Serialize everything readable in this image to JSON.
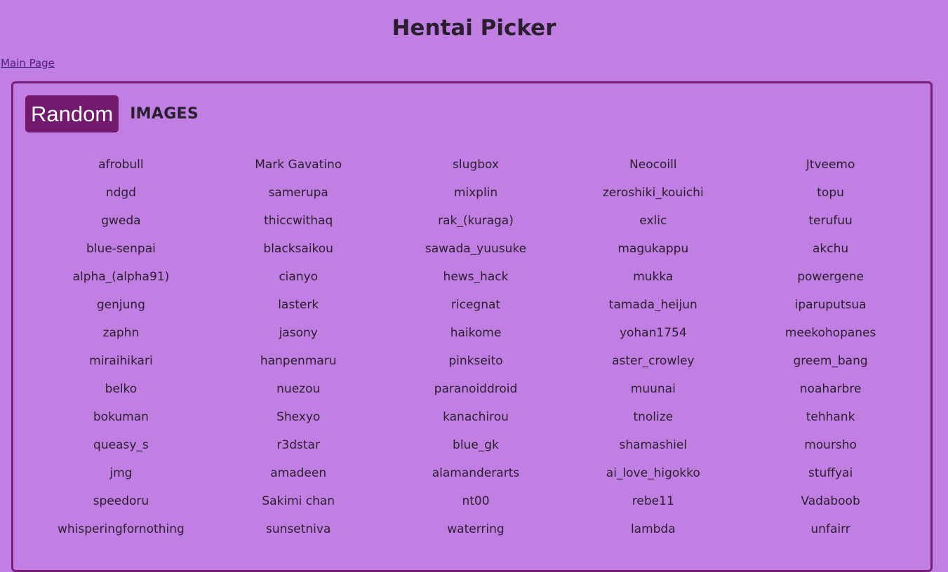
{
  "header": {
    "title": "Hentai Picker",
    "main_link": "Main Page"
  },
  "panel": {
    "random_label": "Random",
    "images_label": "IMAGES",
    "artists": [
      "afrobull",
      "Mark Gavatino",
      "slugbox",
      "Neocoill",
      "Jtveemo",
      "ndgd",
      "samerupa",
      "mixplin",
      "zeroshiki_kouichi",
      "topu",
      "gweda",
      "thiccwithaq",
      "rak_(kuraga)",
      "exlic",
      "terufuu",
      "blue-senpai",
      "blacksaikou",
      "sawada_yuusuke",
      "magukappu",
      "akchu",
      "alpha_(alpha91)",
      "cianyo",
      "hews_hack",
      "mukka",
      "powergene",
      "genjung",
      "lasterk",
      "ricegnat",
      "tamada_heijun",
      "iparuputsua",
      "zaphn",
      "jasony",
      "haikome",
      "yohan1754",
      "meekohopanes",
      "miraihikari",
      "hanpenmaru",
      "pinkseito",
      "aster_crowley",
      "greem_bang",
      "belko",
      "nuezou",
      "paranoiddroid",
      "muunai",
      "noaharbre",
      "bokuman",
      "Shexyo",
      "kanachirou",
      "tnolize",
      "tehhank",
      "queasy_s",
      "r3dstar",
      "blue_gk",
      "shamashiel",
      "moursho",
      "jmg",
      "amadeen",
      "alamanderarts",
      "ai_love_higokko",
      "stuffyai",
      "speedoru",
      "Sakimi chan",
      "nt00",
      "rebe11",
      "Vadaboob",
      "whisperingfornothing",
      "sunsetniva",
      "waterring",
      "lambda",
      "unfairr"
    ]
  }
}
